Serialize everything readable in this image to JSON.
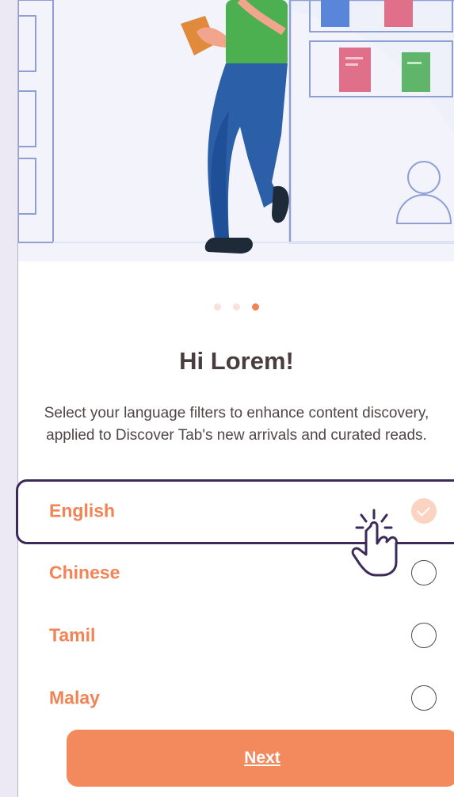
{
  "onboarding": {
    "pager": {
      "total_pages": 3,
      "current_page": 3
    },
    "title": "Hi Lorem!",
    "description": "Select your language filters to enhance content discovery, applied to Discover Tab's new arrivals and curated reads.",
    "languages": [
      {
        "label": "English",
        "selected": true
      },
      {
        "label": "Chinese",
        "selected": false
      },
      {
        "label": "Tamil",
        "selected": false
      },
      {
        "label": "Malay",
        "selected": false
      }
    ],
    "next_label": "Next"
  },
  "colors": {
    "accent": "#f28354",
    "button": "#f28a5e",
    "heading": "#4a3d3f",
    "highlight_outline": "#3b2a5a"
  },
  "icons": {
    "hero": "reading-person-illustration",
    "cursor": "hand-pointer-icon",
    "check": "check-icon"
  }
}
